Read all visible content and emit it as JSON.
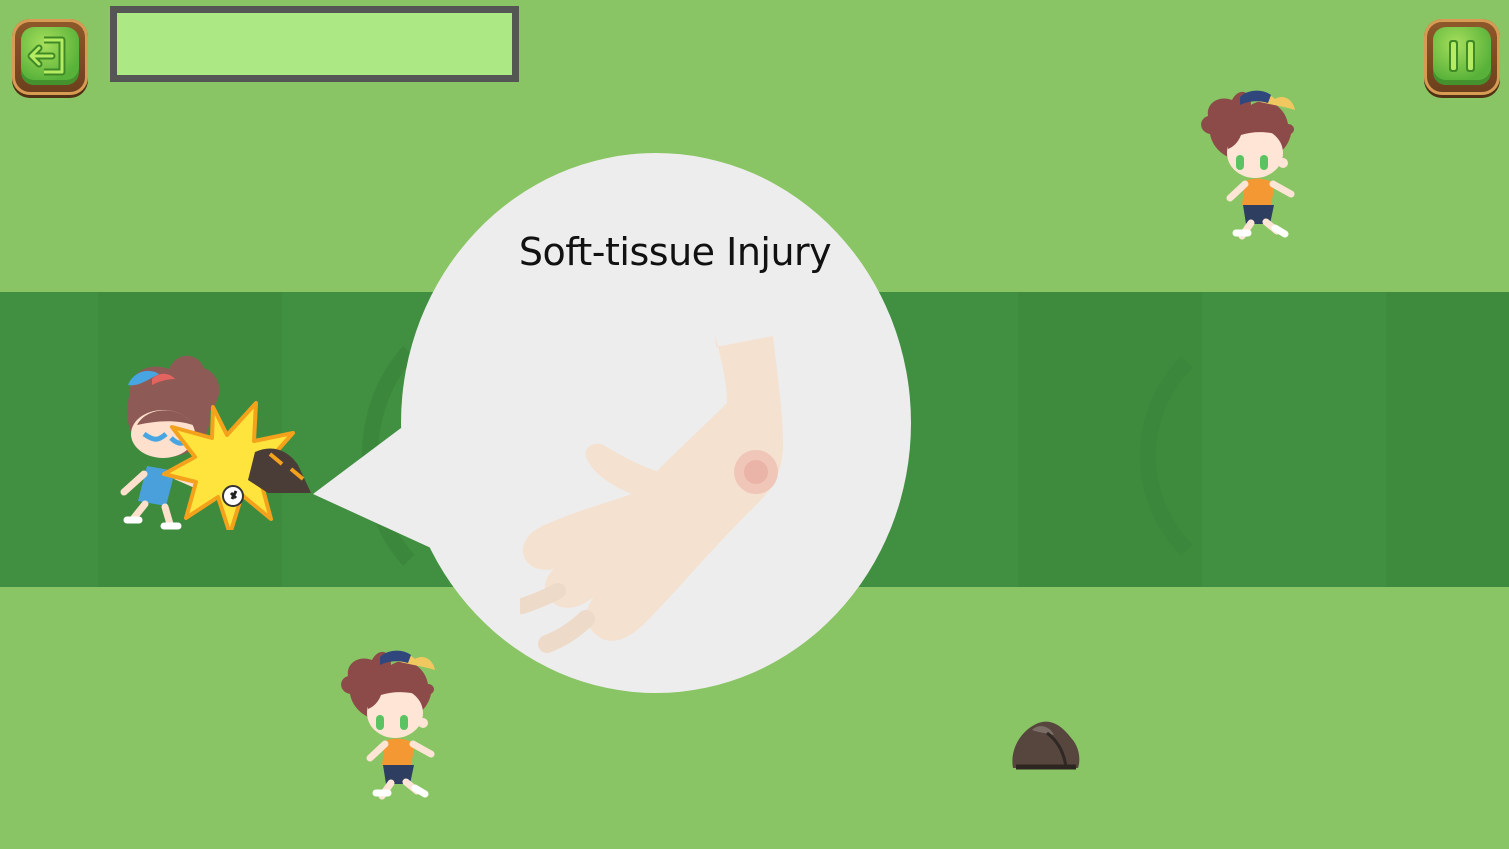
{
  "game": {
    "title": "Soft-tissue Injury",
    "controls": {
      "exit_icon": "exit-icon",
      "pause_icon": "pause-icon"
    },
    "progress": {
      "value": 0
    }
  },
  "colors": {
    "light_grass": "#89c565",
    "dark_band": "#418f40",
    "bubble": "#eeeded",
    "button_wood": "#8f5a2a",
    "button_green": "#7ac94f",
    "progress_fill": "#ace985"
  },
  "scene": {
    "characters": [
      "girl-runner-icon",
      "girl-runner-icon",
      "injured-runner-icon"
    ],
    "obstacles": [
      "rock-icon",
      "rock-icon"
    ],
    "illustration": "arm-bruise-icon"
  }
}
